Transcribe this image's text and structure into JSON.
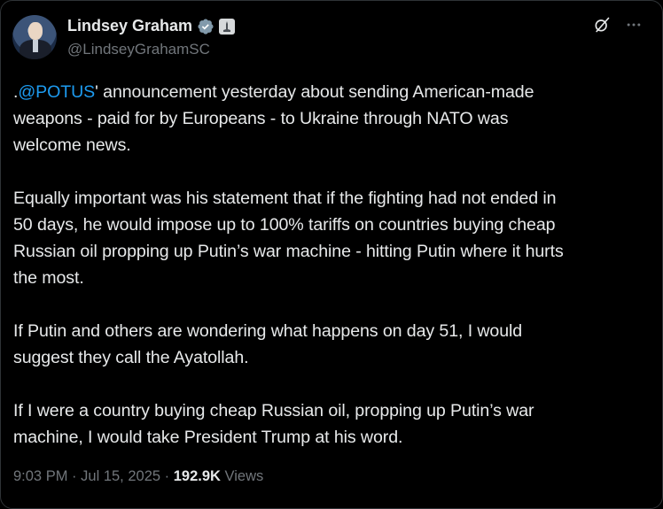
{
  "author": {
    "name": "Lindsey Graham",
    "handle": "@LindseyGrahamSC",
    "verified_color": "#829aab"
  },
  "tweet": {
    "p1_prefix": ".",
    "p1_mention": "@POTUS",
    "p1_line1_rest": "' announcement yesterday about sending American-made",
    "p1_line2": "weapons  - paid for by Europeans - to Ukraine through NATO was",
    "p1_line3": "welcome news.",
    "p2_line1": "Equally important was his statement that if the fighting had not ended in",
    "p2_line2": "50 days, he would impose up to 100% tariffs on countries buying cheap",
    "p2_line3": "Russian oil propping up Putin’s war machine - hitting Putin where it hurts",
    "p2_line4": "the most.",
    "p3_line1": "If Putin and others are wondering what happens on day 51, I would",
    "p3_line2": "suggest they call the Ayatollah.",
    "p4_line1": "If I were a country buying cheap Russian oil, propping up Putin’s war",
    "p4_line2": "machine, I would take President Trump at his word."
  },
  "meta": {
    "time": "9:03 PM",
    "sep1": "·",
    "date": "Jul 15, 2025",
    "sep2": "·",
    "views_count": "192.9K",
    "views_label": "Views"
  },
  "colors": {
    "background": "#000000",
    "text": "#e7e9ea",
    "secondary": "#71767b",
    "link": "#1d9bf0"
  },
  "icons": [
    "verified-badge-icon",
    "government-badge-icon",
    "grok-icon",
    "more-icon"
  ]
}
